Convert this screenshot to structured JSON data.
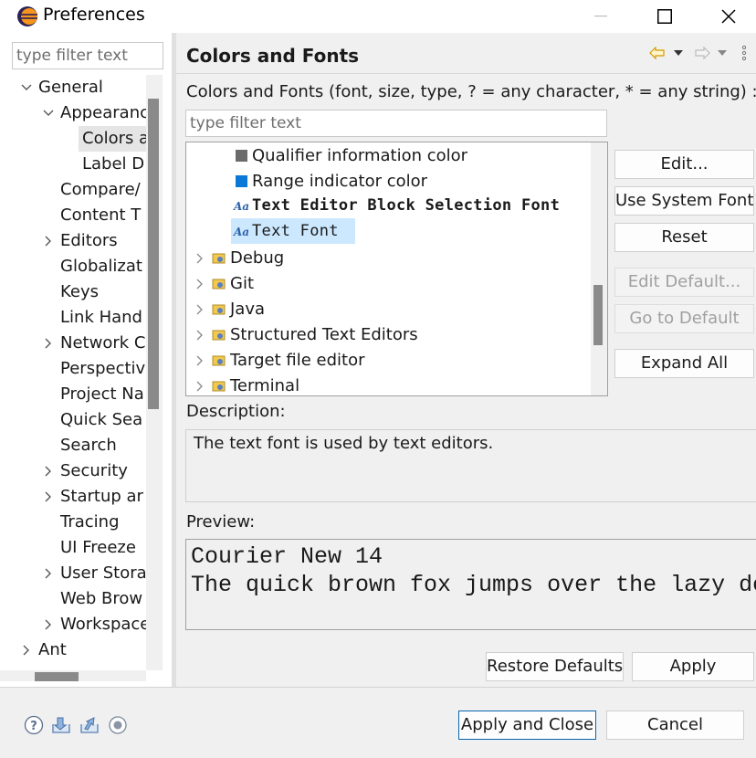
{
  "window": {
    "title": "Preferences",
    "icon": "eclipse-icon",
    "controls": [
      "minimize-icon",
      "maximize-icon",
      "close-icon"
    ]
  },
  "sidebar": {
    "filter_placeholder": "type filter text",
    "items": [
      {
        "label": "General",
        "expanded": true
      },
      {
        "label": "Appearanc",
        "expanded": true
      },
      {
        "label": "Colors a",
        "selected": true
      },
      {
        "label": "Label D"
      },
      {
        "label": "Compare/"
      },
      {
        "label": "Content T"
      },
      {
        "label": "Editors",
        "expandable": true
      },
      {
        "label": "Globalizat"
      },
      {
        "label": "Keys"
      },
      {
        "label": "Link Hand"
      },
      {
        "label": "Network C",
        "expandable": true
      },
      {
        "label": "Perspectiv"
      },
      {
        "label": "Project Na"
      },
      {
        "label": "Quick Sea"
      },
      {
        "label": "Search"
      },
      {
        "label": "Security",
        "expandable": true
      },
      {
        "label": "Startup ar",
        "expandable": true
      },
      {
        "label": "Tracing"
      },
      {
        "label": "UI Freeze"
      },
      {
        "label": "User Stora",
        "expandable": true
      },
      {
        "label": "Web Brow"
      },
      {
        "label": "Workspace",
        "expandable": true
      },
      {
        "label": "Ant",
        "expandable": true
      }
    ]
  },
  "panel": {
    "title": "Colors and Fonts",
    "nav_icons": [
      "back-arrow-icon",
      "dropdown-icon",
      "forward-arrow-icon",
      "dropdown-icon",
      "more-menu-icon"
    ],
    "filter_label": "Colors and Fonts (font, size, type, ? = any character, * = any string) :",
    "filter_placeholder": "type filter text",
    "tree": [
      {
        "label": "Qualifier information color",
        "icon": "color-swatch-icon",
        "color": "#6b6b6b"
      },
      {
        "label": "Range indicator color",
        "icon": "color-swatch-icon",
        "color": "#0a78d7"
      },
      {
        "label": "Text Editor Block Selection Font",
        "icon": "font-icon",
        "bold": true
      },
      {
        "label": "Text Font",
        "icon": "font-icon",
        "selected": true
      },
      {
        "label": "Debug",
        "icon": "category-folder-icon"
      },
      {
        "label": "Git",
        "icon": "category-folder-icon"
      },
      {
        "label": "Java",
        "icon": "category-folder-icon"
      },
      {
        "label": "Structured Text Editors",
        "icon": "category-folder-icon"
      },
      {
        "label": "Target file editor",
        "icon": "category-folder-icon"
      },
      {
        "label": "Terminal",
        "icon": "category-folder-icon"
      }
    ],
    "buttons": {
      "edit": "Edit...",
      "use_system_font": "Use System Font",
      "reset": "Reset",
      "edit_default": "Edit Default...",
      "go_to_default": "Go to Default",
      "expand_all": "Expand All"
    },
    "description_label": "Description:",
    "description_text": "The text font is used by text editors.",
    "preview_label": "Preview:",
    "preview_lines": [
      "Courier New 14",
      "The quick brown fox jumps over the lazy dog."
    ],
    "restore_defaults": "Restore Defaults",
    "apply": "Apply"
  },
  "footer": {
    "icons": [
      "help-icon",
      "import-icon",
      "export-icon",
      "record-icon"
    ],
    "apply_and_close": "Apply and Close",
    "cancel": "Cancel"
  }
}
